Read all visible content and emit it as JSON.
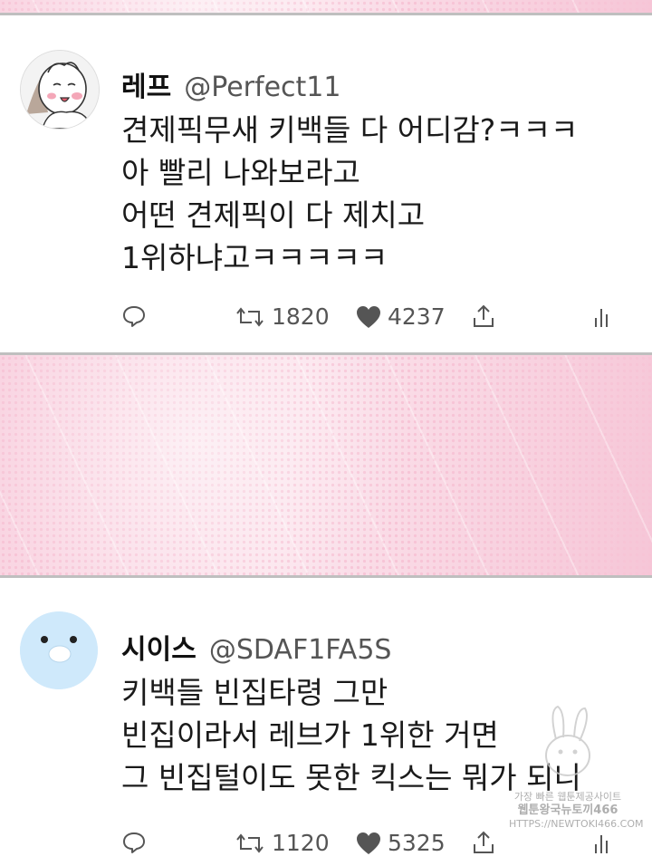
{
  "tweets": [
    {
      "display_name": "레프",
      "handle": "@Perfect11",
      "lines": [
        "견제픽무새 키백들 다 어디감?ㅋㅋㅋ",
        "아 빨리 나와보라고",
        "어떤 견제픽이 다 제치고",
        "1위하냐고ㅋㅋㅋㅋㅋ"
      ],
      "retweets": "1820",
      "likes": "4237",
      "avatar_icon": "cartoon-character-avatar"
    },
    {
      "display_name": "시이스",
      "handle": "@SDAF1FA5S",
      "lines": [
        "키백들 빈집타령 그만",
        "빈집이라서 레브가 1위한 거면",
        "그 빈집털이도 못한 킥스는 뭐가 되니"
      ],
      "retweets": "1120",
      "likes": "5325",
      "avatar_icon": "surprised-face-avatar"
    }
  ],
  "watermark": {
    "line1": "가장 빠른 웹툰제공사이트",
    "line2": "웹툰왕국뉴토끼466",
    "line3": "HTTPS://NEWTOKI466.COM"
  },
  "colors": {
    "pink": "#f7c4d6",
    "avatar_blue": "#cfe9fb",
    "text": "#1a1a1a",
    "muted": "#555555",
    "divider": "#bfbfbf"
  }
}
